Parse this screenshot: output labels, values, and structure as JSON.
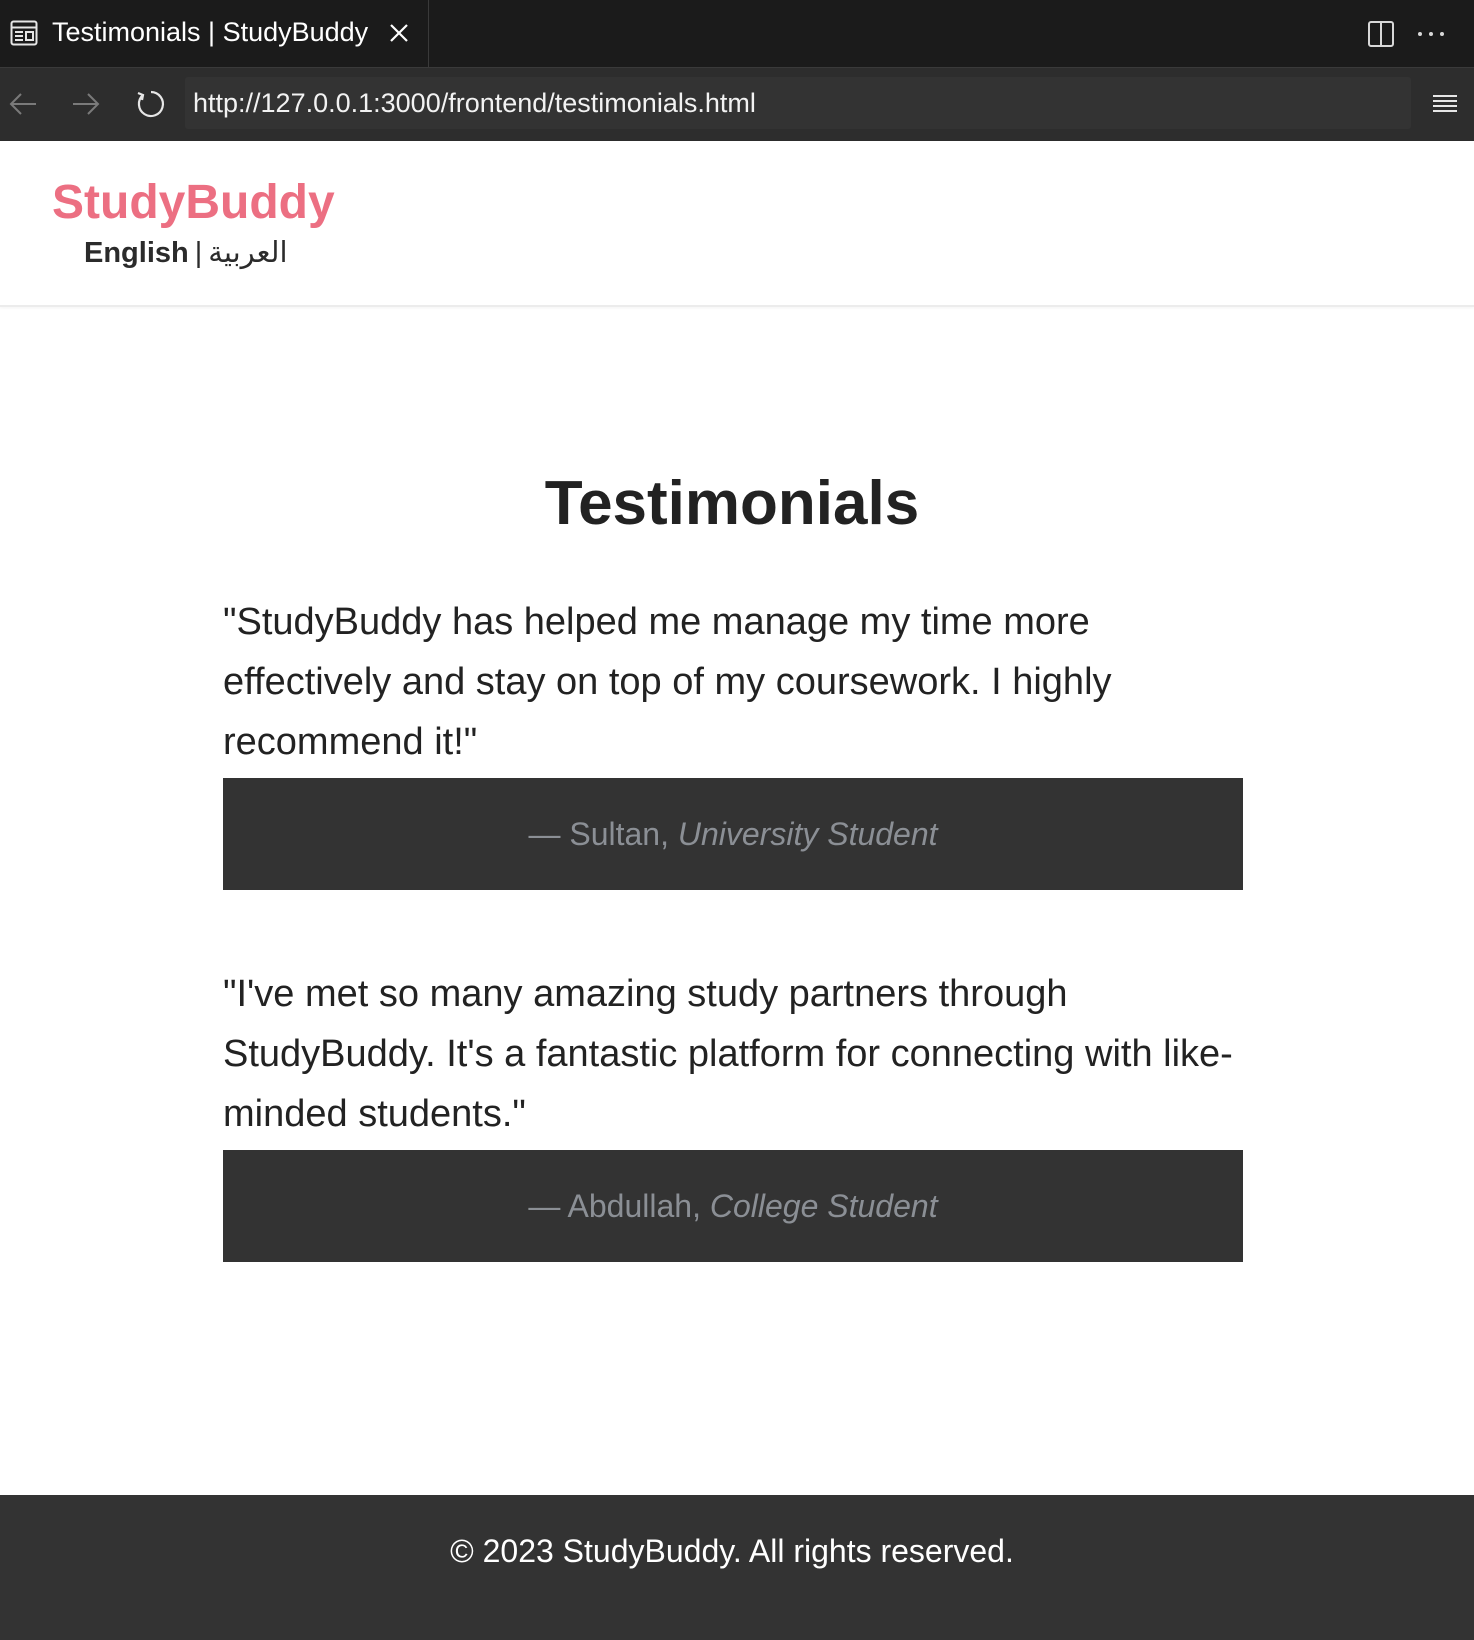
{
  "browser": {
    "tab_title": "Testimonials | StudyBuddy",
    "url": "http://127.0.0.1:3000/frontend/testimonials.html",
    "icons": {
      "tab": "page-icon",
      "close": "close-icon",
      "split": "split-view-icon",
      "more": "more-icon",
      "back": "back-arrow-icon",
      "forward": "forward-arrow-icon",
      "reload": "reload-icon",
      "menu": "menu-icon"
    }
  },
  "header": {
    "logo": "StudyBuddy",
    "lang_english": "English",
    "lang_separator": "|",
    "lang_arabic": "العربية"
  },
  "main": {
    "title": "Testimonials",
    "testimonials": [
      {
        "quote": "\"StudyBuddy has helped me manage my time more effectively and stay on top of my coursework. I highly recommend it!\"",
        "author": "— Sultan,",
        "role": "University Student"
      },
      {
        "quote": "\"I've met so many amazing study partners through StudyBuddy. It's a fantastic platform for connecting with like-minded students.\"",
        "author": "— Abdullah,",
        "role": "College Student"
      }
    ]
  },
  "footer": {
    "text": "© 2023 StudyBuddy. All rights reserved."
  },
  "colors": {
    "brand": "#ec6f82",
    "dark_panel": "#333333",
    "author_text": "#8b8f95",
    "chrome_bg": "#1b1b1b",
    "toolbar_bg": "#2d2d2d"
  }
}
